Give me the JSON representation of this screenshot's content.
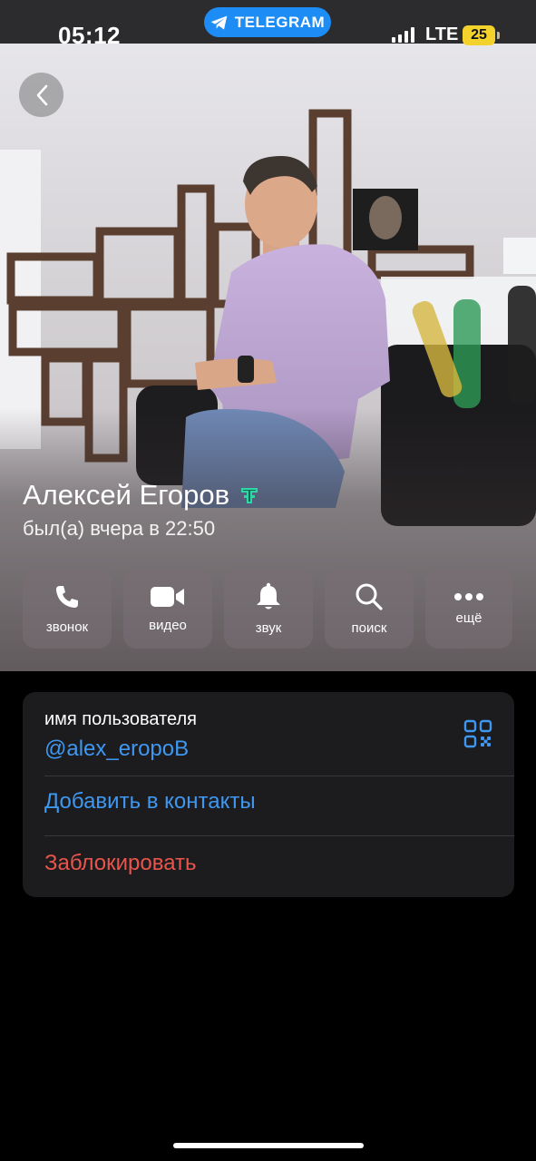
{
  "status_bar": {
    "time": "05:12",
    "app_pill": "TELEGRAM",
    "network": "LTE",
    "battery": "25",
    "battery_color": "#f3d22b"
  },
  "profile": {
    "name": "Алексей Егоров",
    "last_seen": "был(а) вчера в 22:50",
    "badge_icon": "telegram-premium-badge-icon"
  },
  "actions": [
    {
      "label": "звонок",
      "icon": "phone-icon"
    },
    {
      "label": "видео",
      "icon": "video-camera-icon"
    },
    {
      "label": "звук",
      "icon": "bell-icon"
    },
    {
      "label": "поиск",
      "icon": "search-icon"
    },
    {
      "label": "ещё",
      "icon": "more-dots-icon"
    }
  ],
  "info": {
    "username_label": "имя пользователя",
    "username": "@alex_eropoB",
    "add_contact": "Добавить в контакты",
    "block": "Заблокировать"
  },
  "colors": {
    "accent": "#3e97f0",
    "danger": "#e9554c",
    "card_bg": "#1c1c1e",
    "pill_bg": "#1d8cf4"
  }
}
